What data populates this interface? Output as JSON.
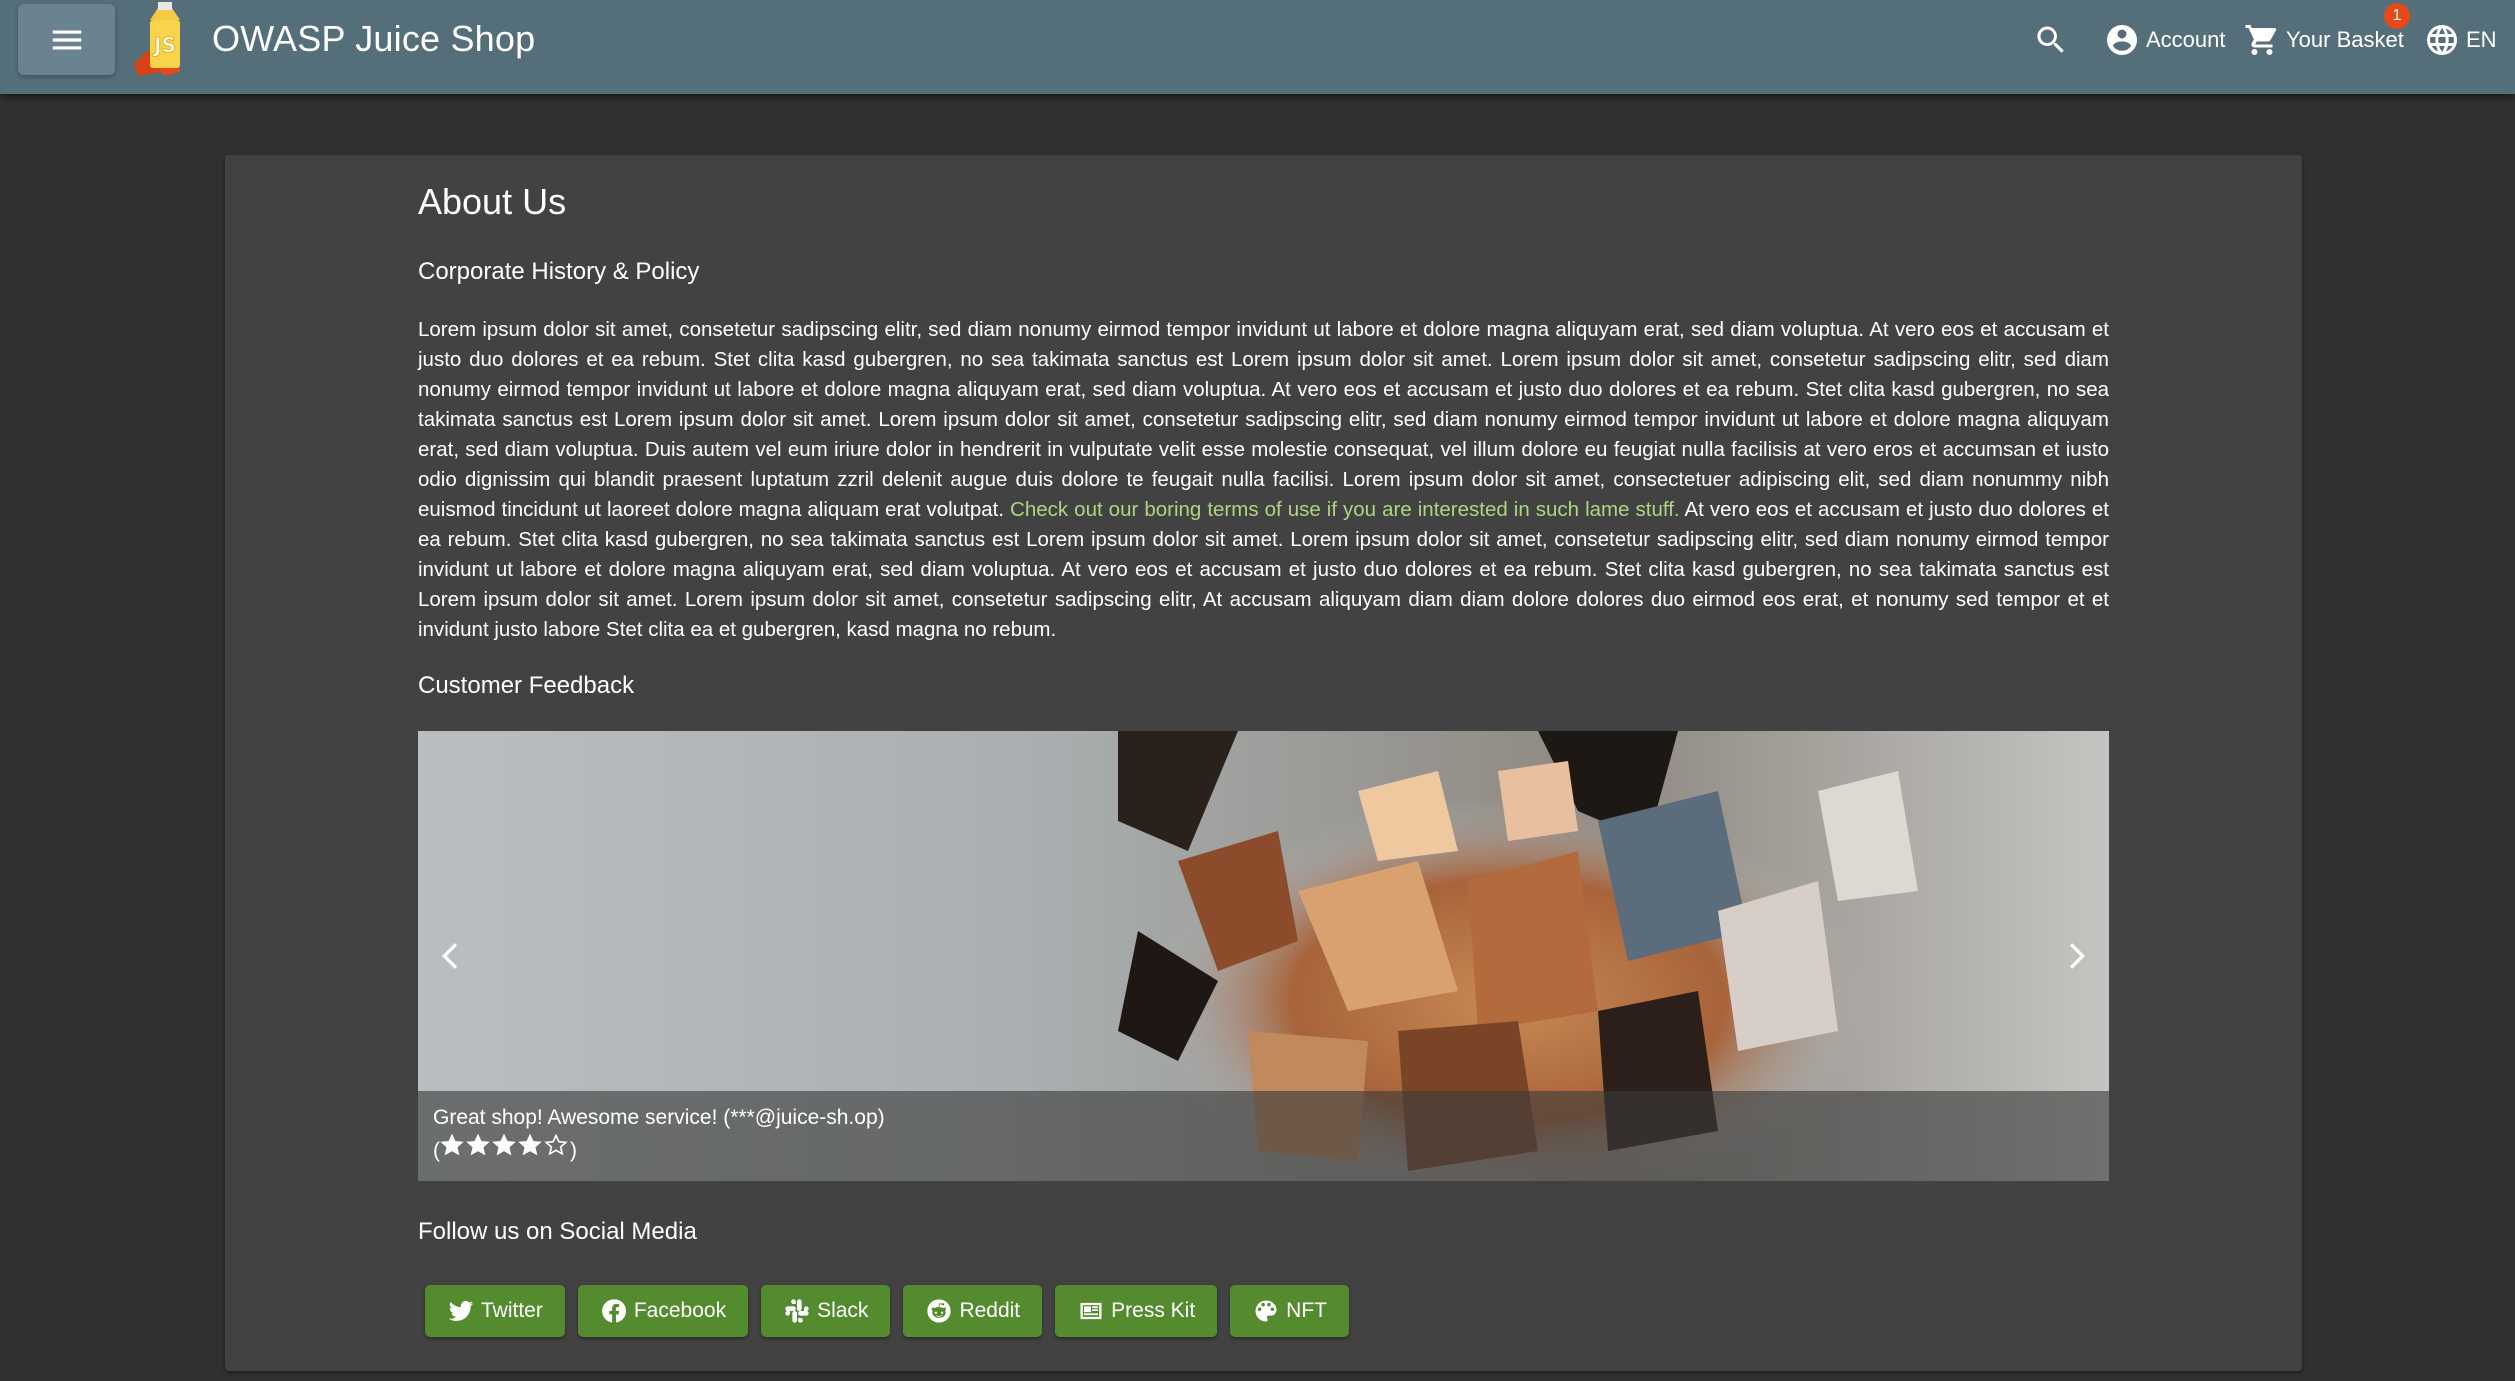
{
  "toolbar": {
    "title": "OWASP Juice Shop",
    "account_label": "Account",
    "basket_label": "Your Basket",
    "basket_count": "1",
    "language_label": "EN",
    "icons": {
      "menu": "menu-icon",
      "search": "search-icon",
      "account": "account-circle-icon",
      "basket": "shopping-cart-icon",
      "language": "globe-icon"
    },
    "color": "#546e7a"
  },
  "page": {
    "title": "About Us",
    "corporate_heading": "Corporate History & Policy",
    "lorem_before": "Lorem ipsum dolor sit amet, consetetur sadipscing elitr, sed diam nonumy eirmod tempor invidunt ut labore et dolore magna aliquyam erat, sed diam voluptua. At vero eos et accusam et justo duo dolores et ea rebum. Stet clita kasd gubergren, no sea takimata sanctus est Lorem ipsum dolor sit amet. Lorem ipsum dolor sit amet, consetetur sadipscing elitr, sed diam nonumy eirmod tempor invidunt ut labore et dolore magna aliquyam erat, sed diam voluptua. At vero eos et accusam et justo duo dolores et ea rebum. Stet clita kasd gubergren, no sea takimata sanctus est Lorem ipsum dolor sit amet. Lorem ipsum dolor sit amet, consetetur sadipscing elitr, sed diam nonumy eirmod tempor invidunt ut labore et dolore magna aliquyam erat, sed diam voluptua. Duis autem vel eum iriure dolor in hendrerit in vulputate velit esse molestie consequat, vel illum dolore eu feugiat nulla facilisis at vero eros et accumsan et iusto odio dignissim qui blandit praesent luptatum zzril delenit augue duis dolore te feugait nulla facilisi. Lorem ipsum dolor sit amet, consectetuer adipiscing elit, sed diam nonummy nibh euismod tincidunt ut laoreet dolore magna aliquam erat volutpat.",
    "terms_link": "Check out our boring terms of use if you are interested in such lame stuff.",
    "lorem_after": "At vero eos et accusam et justo duo dolores et ea rebum. Stet clita kasd gubergren, no sea takimata sanctus est Lorem ipsum dolor sit amet. Lorem ipsum dolor sit amet, consetetur sadipscing elitr, sed diam nonumy eirmod tempor invidunt ut labore et dolore magna aliquyam erat, sed diam voluptua. At vero eos et accusam et justo duo dolores et ea rebum. Stet clita kasd gubergren, no sea takimata sanctus est Lorem ipsum dolor sit amet. Lorem ipsum dolor sit amet, consetetur sadipscing elitr, At accusam aliquyam diam diam dolore dolores duo eirmod eos erat, et nonumy sed tempor et et invidunt justo labore Stet clita ea et gubergren, kasd magna no rebum.",
    "feedback_heading": "Customer Feedback",
    "feedback": {
      "comment": "Great shop! Awesome service! (***@juice-sh.op)",
      "stars_open": "(",
      "stars_close": ")",
      "rating": 4,
      "max_rating": 5
    },
    "social_heading": "Follow us on Social Media",
    "social_buttons": [
      {
        "label": "Twitter",
        "icon": "twitter-icon"
      },
      {
        "label": "Facebook",
        "icon": "facebook-icon"
      },
      {
        "label": "Slack",
        "icon": "slack-icon"
      },
      {
        "label": "Reddit",
        "icon": "reddit-icon"
      },
      {
        "label": "Press Kit",
        "icon": "newspaper-icon"
      },
      {
        "label": "NFT",
        "icon": "palette-icon"
      }
    ],
    "accent_color": "#558b2f",
    "link_color": "#aed581"
  }
}
